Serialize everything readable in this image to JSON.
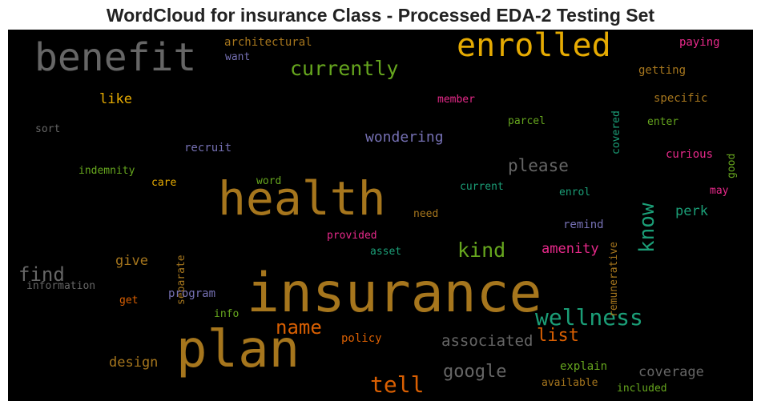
{
  "title": "WordCloud for insurance Class - Processed EDA-2 Testing Set",
  "words": [
    {
      "text": "insurance",
      "color": "#a6761d"
    },
    {
      "text": "plan",
      "color": "#a6761d"
    },
    {
      "text": "health",
      "color": "#a6761d"
    },
    {
      "text": "benefit",
      "color": "#666666"
    },
    {
      "text": "enrolled",
      "color": "#e6ab02"
    },
    {
      "text": "wellness",
      "color": "#1b9e77"
    },
    {
      "text": "currently",
      "color": "#66a61e"
    },
    {
      "text": "tell",
      "color": "#d95f02"
    },
    {
      "text": "know",
      "color": "#1b9e77"
    },
    {
      "text": "kind",
      "color": "#66a61e"
    },
    {
      "text": "name",
      "color": "#d95f02"
    },
    {
      "text": "find",
      "color": "#666666"
    },
    {
      "text": "google",
      "color": "#666666"
    },
    {
      "text": "please",
      "color": "#666666"
    },
    {
      "text": "list",
      "color": "#d95f02"
    },
    {
      "text": "associated",
      "color": "#666666"
    },
    {
      "text": "wondering",
      "color": "#7570b3"
    },
    {
      "text": "amenity",
      "color": "#e7298a"
    },
    {
      "text": "coverage",
      "color": "#666666"
    },
    {
      "text": "perk",
      "color": "#1b9e77"
    },
    {
      "text": "design",
      "color": "#a6761d"
    },
    {
      "text": "give",
      "color": "#a6761d"
    },
    {
      "text": "like",
      "color": "#e6ab02"
    },
    {
      "text": "architectural",
      "color": "#a6761d"
    },
    {
      "text": "want",
      "color": "#7570b3"
    },
    {
      "text": "paying",
      "color": "#e7298a"
    },
    {
      "text": "getting",
      "color": "#a6761d"
    },
    {
      "text": "specific",
      "color": "#a6761d"
    },
    {
      "text": "member",
      "color": "#e7298a"
    },
    {
      "text": "covered",
      "color": "#1b9e77"
    },
    {
      "text": "parcel",
      "color": "#66a61e"
    },
    {
      "text": "enter",
      "color": "#66a61e"
    },
    {
      "text": "good",
      "color": "#66a61e"
    },
    {
      "text": "curious",
      "color": "#e7298a"
    },
    {
      "text": "sort",
      "color": "#666666"
    },
    {
      "text": "recruit",
      "color": "#7570b3"
    },
    {
      "text": "indemnity",
      "color": "#66a61e"
    },
    {
      "text": "care",
      "color": "#e6ab02"
    },
    {
      "text": "word",
      "color": "#66a61e"
    },
    {
      "text": "current",
      "color": "#1b9e77"
    },
    {
      "text": "enrol",
      "color": "#1b9e77"
    },
    {
      "text": "may",
      "color": "#e7298a"
    },
    {
      "text": "remunerative",
      "color": "#a6761d"
    },
    {
      "text": "separate",
      "color": "#a6761d"
    },
    {
      "text": "need",
      "color": "#a6761d"
    },
    {
      "text": "remind",
      "color": "#7570b3"
    },
    {
      "text": "provided",
      "color": "#e7298a"
    },
    {
      "text": "asset",
      "color": "#1b9e77"
    },
    {
      "text": "information",
      "color": "#666666"
    },
    {
      "text": "program",
      "color": "#7570b3"
    },
    {
      "text": "get",
      "color": "#d95f02"
    },
    {
      "text": "info",
      "color": "#66a61e"
    },
    {
      "text": "policy",
      "color": "#d95f02"
    },
    {
      "text": "explain",
      "color": "#66a61e"
    },
    {
      "text": "available",
      "color": "#a6761d"
    },
    {
      "text": "included",
      "color": "#66a61e"
    }
  ]
}
